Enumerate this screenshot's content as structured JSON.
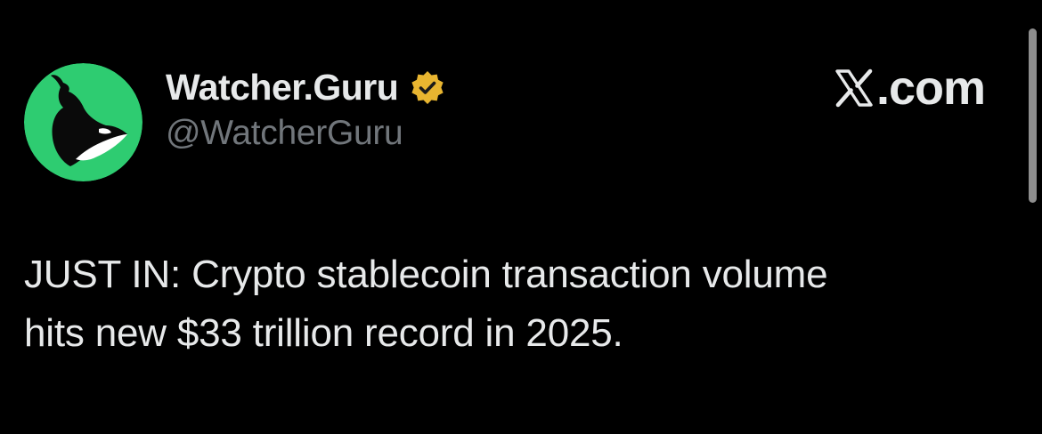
{
  "author": {
    "display_name": "Watcher.Guru",
    "handle": "@WatcherGuru",
    "avatar_icon": "whale-logo-icon",
    "avatar_bg": "#2ecc71",
    "verified_icon": "verified-badge-icon",
    "verified_color": "#e8b530"
  },
  "site": {
    "label": ".com",
    "logo_icon": "x-logo-icon"
  },
  "tweet": {
    "lines": [
      "JUST IN: Crypto stablecoin transaction volume",
      "hits new $33 trillion record in 2025."
    ]
  },
  "colors": {
    "background": "#000000",
    "text": "#e7e9ea",
    "muted": "#71767b"
  }
}
